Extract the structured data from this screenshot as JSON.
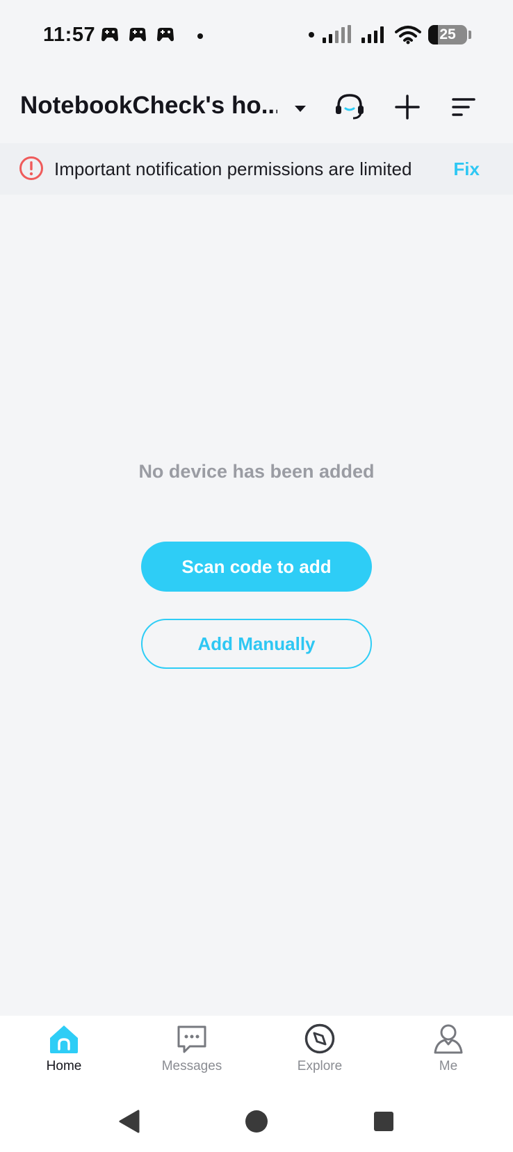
{
  "status_bar": {
    "time": "11:57",
    "battery": "25",
    "battery_level": 0.25
  },
  "header": {
    "home_name": "NotebookCheck's ho..."
  },
  "banner": {
    "message": "Important notification permissions are limited",
    "action": "Fix"
  },
  "empty_state": {
    "message": "No device has been added",
    "scan_button": "Scan code to add",
    "manual_button": "Add Manually"
  },
  "bottom_nav": {
    "items": [
      {
        "label": "Home",
        "icon": "home-icon",
        "active": true
      },
      {
        "label": "Messages",
        "icon": "chat-icon",
        "active": false
      },
      {
        "label": "Explore",
        "icon": "compass-icon",
        "active": false
      },
      {
        "label": "Me",
        "icon": "person-icon",
        "active": false
      }
    ]
  },
  "colors": {
    "accent": "#2ecdf6",
    "warning": "#ef5b5b",
    "background": "#f4f5f7"
  }
}
